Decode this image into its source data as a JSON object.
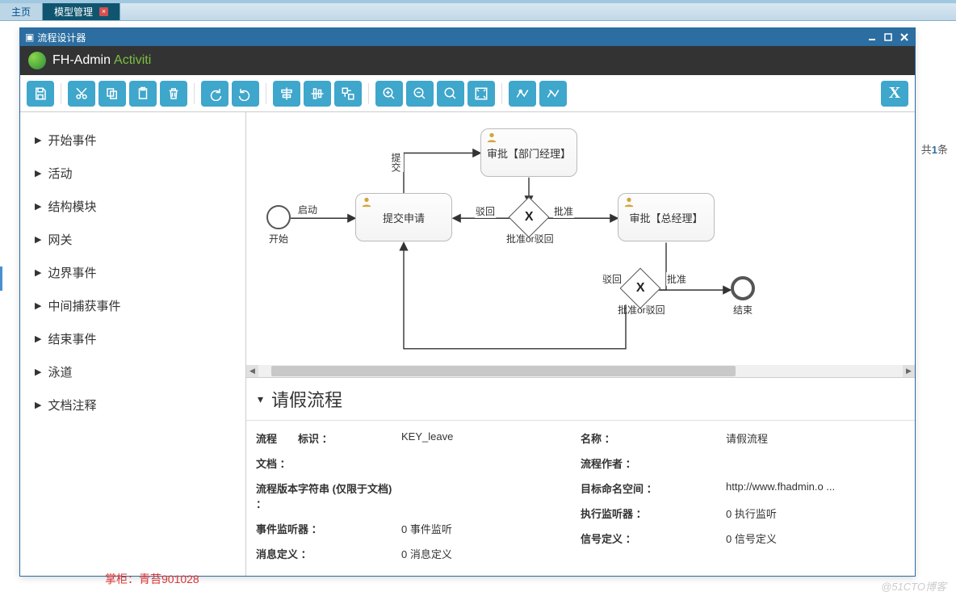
{
  "tabs": {
    "home": "主页",
    "model": "模型管理"
  },
  "window": {
    "title": "流程设计器",
    "brand": "FH-Admin",
    "brand2": "Activiti",
    "close_x": "X"
  },
  "palette": [
    "开始事件",
    "活动",
    "结构模块",
    "网关",
    "边界事件",
    "中间捕获事件",
    "结束事件",
    "泳道",
    "文档注释"
  ],
  "nodes": {
    "start": "开始",
    "end": "结束",
    "submit": "提交申请",
    "dept": "审批【部门经理】",
    "gm": "审批【总经理】",
    "gw1": "批准or驳回",
    "gw2": "批准or驳回"
  },
  "edges": {
    "start_submit": "启动",
    "submit_dept": "提交",
    "dept_gw1_left": "驳回",
    "dept_gw1_right": "批准",
    "gm_gw2_left": "驳回",
    "gm_gw2_right": "批准"
  },
  "props": {
    "title": "请假流程",
    "left": {
      "id_label": "流程　　标识 ：",
      "id_val": "KEY_leave",
      "doc_label": "文档 ：",
      "ver_label": "流程版本字符串 (仅限于文档) ：",
      "evt_label": "事件监听器 ：",
      "evt_val": "0 事件监听",
      "msg_label": "消息定义 ：",
      "msg_val": "0 消息定义"
    },
    "right": {
      "name_label": "名称 ：",
      "name_val": "请假流程",
      "author_label": "流程作者 ：",
      "ns_label": "目标命名空间 ：",
      "ns_val": "http://www.fhadmin.o ...",
      "exec_label": "执行监听器 ：",
      "exec_val": "0 执行监听",
      "sig_label": "信号定义 ：",
      "sig_val": "0 信号定义"
    }
  },
  "footer": "掌柜：青苔901028",
  "watermark": "@51CTO博客",
  "sidecount_prefix": "共",
  "sidecount_n": "1",
  "sidecount_suffix": "条"
}
